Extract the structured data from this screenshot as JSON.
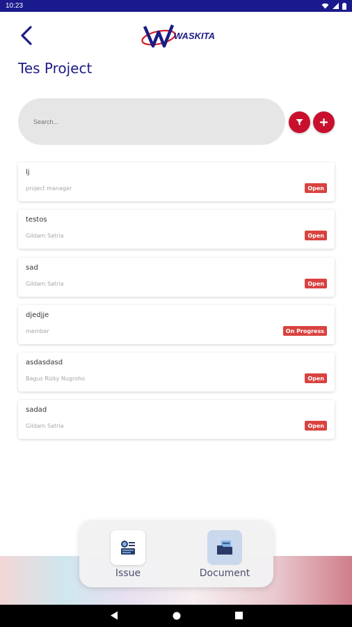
{
  "status_bar": {
    "time": "10:23"
  },
  "header": {
    "logo_text": "WASKITA",
    "title": "Tes Project"
  },
  "search": {
    "placeholder": "Search..."
  },
  "projects": [
    {
      "name": "lj",
      "subtitle": "project manager",
      "status": "Open"
    },
    {
      "name": "testos",
      "subtitle": "Gildam Satria",
      "status": "Open"
    },
    {
      "name": "sad",
      "subtitle": "Gildam Satria",
      "status": "Open"
    },
    {
      "name": "djedjje",
      "subtitle": "member",
      "status": "On Progress"
    },
    {
      "name": "asdasdasd",
      "subtitle": "Bagus Rizky Nugroho",
      "status": "Open"
    },
    {
      "name": "sadad",
      "subtitle": "Gildam Satria",
      "status": "Open"
    }
  ],
  "bottom_nav": {
    "issue_label": "Issue",
    "document_label": "Document"
  },
  "colors": {
    "brand_blue": "#1c1c84",
    "accent_red": "#c8102e",
    "badge_red": "#d9423f"
  }
}
